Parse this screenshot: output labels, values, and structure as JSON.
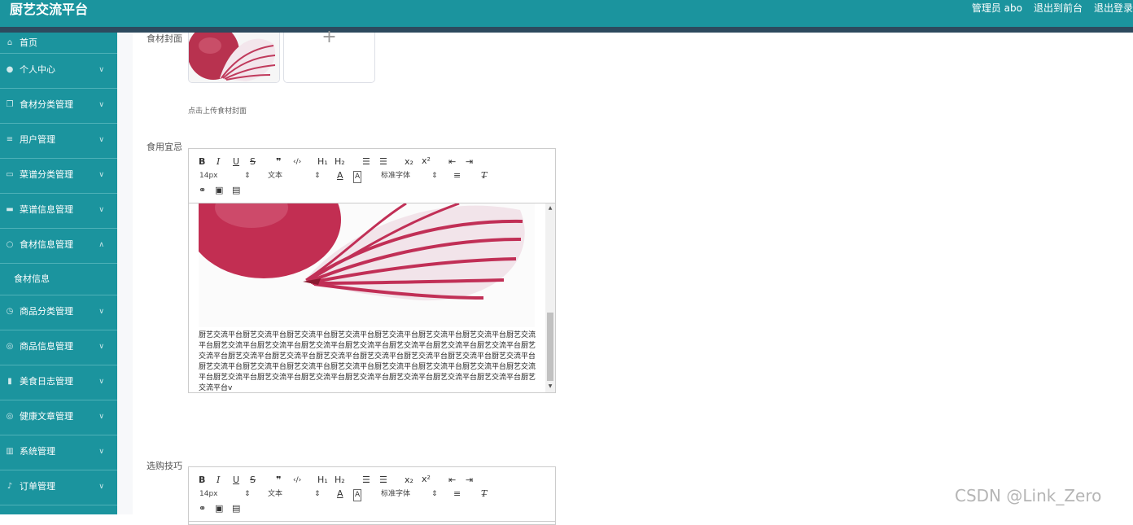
{
  "header": {
    "title": "厨艺交流平台",
    "admin_label": "管理员 abo",
    "to_front_label": "退出到前台",
    "logout_label": "退出登录"
  },
  "sidebar": {
    "items": [
      {
        "label": "首页",
        "icon": "home-icon"
      },
      {
        "label": "个人中心",
        "icon": "user-icon"
      },
      {
        "label": "食材分类管理",
        "icon": "copy-icon"
      },
      {
        "label": "用户管理",
        "icon": "list-icon"
      },
      {
        "label": "菜谱分类管理",
        "icon": "chat-icon"
      },
      {
        "label": "菜谱信息管理",
        "icon": "monitor-icon"
      },
      {
        "label": "食材信息管理",
        "icon": "power-icon"
      },
      {
        "label": "商品分类管理",
        "icon": "clock-icon"
      },
      {
        "label": "商品信息管理",
        "icon": "compass-icon"
      },
      {
        "label": "美食日志管理",
        "icon": "thumb-icon"
      },
      {
        "label": "健康文章管理",
        "icon": "compass-icon"
      },
      {
        "label": "系统管理",
        "icon": "bars-icon"
      },
      {
        "label": "订单管理",
        "icon": "mic-icon"
      }
    ],
    "sub_item": "食材信息"
  },
  "form": {
    "cover_label": "食材封面",
    "cover_hint": "点击上传食材封面",
    "upload_plus": "+",
    "usage_label": "食用宜忌",
    "tips_label": "选购技巧"
  },
  "editor": {
    "toolbar": {
      "bold": "B",
      "italic": "I",
      "underline": "U",
      "strike": "S",
      "quote": "❞",
      "code": "‹/›",
      "h1": "H₁",
      "h2": "H₂",
      "ordered_list": "☰",
      "bullet_list": "☰",
      "subscript": "x₂",
      "superscript": "x²",
      "outdent": "⇤",
      "indent": "⇥",
      "size": "14px",
      "size_arrow": "⇕",
      "header": "文本",
      "header_arrow": "⇕",
      "color": "A",
      "background": "A",
      "font": "标准字体",
      "font_arrow": "⇕",
      "align": "≡",
      "clean": "T̶",
      "link": "⚭",
      "image": "▣",
      "video": "▤"
    },
    "content_text": "厨艺交流平台厨艺交流平台厨艺交流平台厨艺交流平台厨艺交流平台厨艺交流平台厨艺交流平台厨艺交流平台厨艺交流平台厨艺交流平台厨艺交流平台厨艺交流平台厨艺交流平台厨艺交流平台厨艺交流平台厨艺交流平台厨艺交流平台厨艺交流平台厨艺交流平台厨艺交流平台厨艺交流平台厨艺交流平台厨艺交流平台厨艺交流平台厨艺交流平台厨艺交流平台厨艺交流平台厨艺交流平台厨艺交流平台厨艺交流平台厨艺交流平台厨艺交流平台厨艺交流平台厨艺交流平台厨艺交流平台厨艺交流平台厨艺交流平台厨艺交流平台厨艺交流平台v"
  },
  "watermark": "CSDN @Link_Zero",
  "colors": {
    "brand": "#1b949e",
    "strip": "#2d4a5e"
  }
}
